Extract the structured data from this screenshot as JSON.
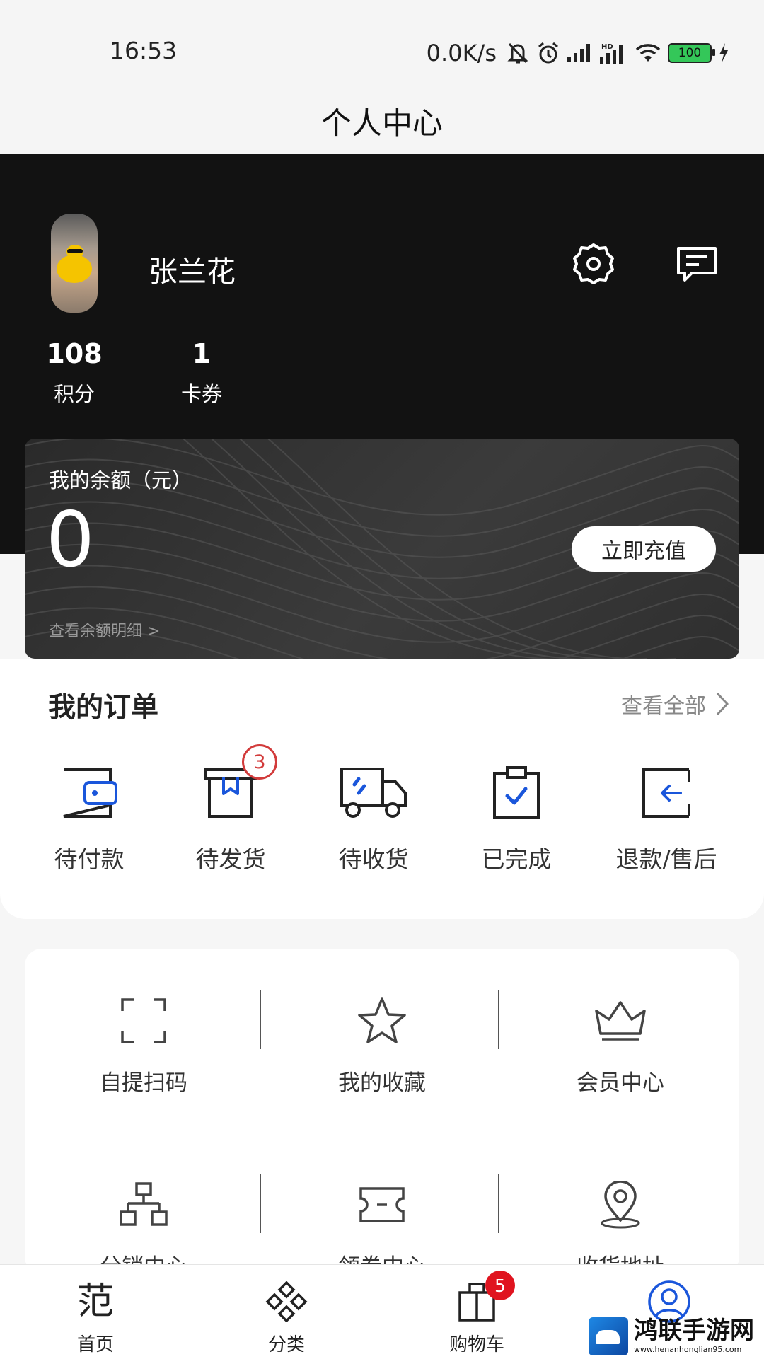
{
  "status_bar": {
    "time": "16:53",
    "net_speed": "0.0K/s",
    "battery": "100",
    "icons": [
      "mute-bell-icon",
      "alarm-icon",
      "signal-icon",
      "hd-signal-icon",
      "wifi-icon",
      "battery-icon",
      "charging-icon"
    ]
  },
  "header": {
    "title": "个人中心"
  },
  "profile": {
    "name": "张兰花",
    "stats": [
      {
        "value": "108",
        "label": "积分"
      },
      {
        "value": "1",
        "label": "卡券"
      }
    ]
  },
  "balance": {
    "title": "我的余额（元）",
    "value": "0",
    "detail_link": "查看余额明细 >",
    "recharge_label": "立即充值"
  },
  "orders": {
    "title": "我的订单",
    "view_all": "查看全部",
    "items": [
      {
        "label": "待付款",
        "icon": "wallet-icon"
      },
      {
        "label": "待发货",
        "icon": "package-icon",
        "badge": "3"
      },
      {
        "label": "待收货",
        "icon": "truck-icon"
      },
      {
        "label": "已完成",
        "icon": "clipboard-check-icon"
      },
      {
        "label": "退款/售后",
        "icon": "return-icon"
      }
    ]
  },
  "services": [
    {
      "label": "自提扫码",
      "icon": "scan-icon"
    },
    {
      "label": "我的收藏",
      "icon": "star-icon"
    },
    {
      "label": "会员中心",
      "icon": "crown-icon"
    },
    {
      "label": "分销中心",
      "icon": "org-chart-icon"
    },
    {
      "label": "领券中心",
      "icon": "ticket-icon"
    },
    {
      "label": "收货地址",
      "icon": "location-pin-icon"
    }
  ],
  "bottom_nav": [
    {
      "label": "首页",
      "icon": "home-icon",
      "glyph": "范"
    },
    {
      "label": "分类",
      "icon": "category-icon"
    },
    {
      "label": "购物车",
      "icon": "cart-icon",
      "badge": "5"
    },
    {
      "label": "",
      "icon": "profile-icon"
    }
  ],
  "watermark": {
    "title": "鸿联手游网",
    "url": "www.henanhonglian95.com"
  },
  "colors": {
    "accent": "#1a56db",
    "badge": "#e0141f",
    "header_bg": "#121212"
  }
}
